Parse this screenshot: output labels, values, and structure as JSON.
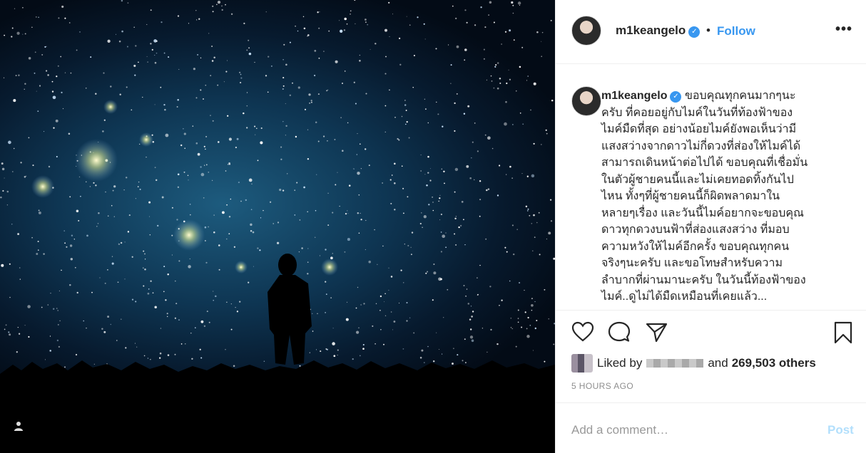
{
  "post": {
    "username": "m1keangelo",
    "follow_label": "Follow",
    "separator": "•",
    "more_label": "•••"
  },
  "caption": {
    "username": "m1keangelo",
    "text": "ขอบคุณทุกคนมากๆนะ\nครับ ที่คอยอยู่กับไมค์ในวันที่ท้องฟ้าของ\nไมค์มืดที่สุด อย่างน้อยไมค์ยังพอเห็นว่ามี\nแสงสว่างจากดาวไม่กี่ดวงที่ส่องให้ไมค์ได้\nสามารถเดินหน้าต่อไปได้ ขอบคุณที่เชื่อมั่น\nในตัวผู้ชายคนนี้และไม่เคยทอดทิ้งกันไป\nไหน ทั้งๆที่ผู้ชายคนนี้ก็ผิดพลาดมาใน\nหลายๆเรื่อง และวันนี้ไมค์อยากจะขอบคุณ\nดาวทุกดวงบนฟ้าที่ส่องแสงสว่าง ที่มอบ\nความหวังให้ไมค์อีกครั้ง ขอบคุณทุกคน\nจริงๆนะครับ และขอโทษสำหรับความ\nลำบากที่ผ่านมานะครับ ในวันนี้ท้องฟ้าของ\nไมค์..ดูไม่ได้มืดเหมือนที่เคยแล้ว..."
  },
  "engagement": {
    "liked_by_label": "Liked by",
    "and_label": "and",
    "others_count": "269,503 others",
    "timestamp": "5 HOURS AGO"
  },
  "comment": {
    "placeholder": "Add a comment…",
    "post_label": "Post"
  },
  "colors": {
    "accent": "#3897f0",
    "post_disabled": "#b2dffc",
    "muted": "#8e8e8e"
  },
  "icons": [
    "user-tag-icon",
    "verified-badge-icon",
    "heart-icon",
    "comment-icon",
    "share-icon",
    "bookmark-icon",
    "more-options-icon"
  ]
}
